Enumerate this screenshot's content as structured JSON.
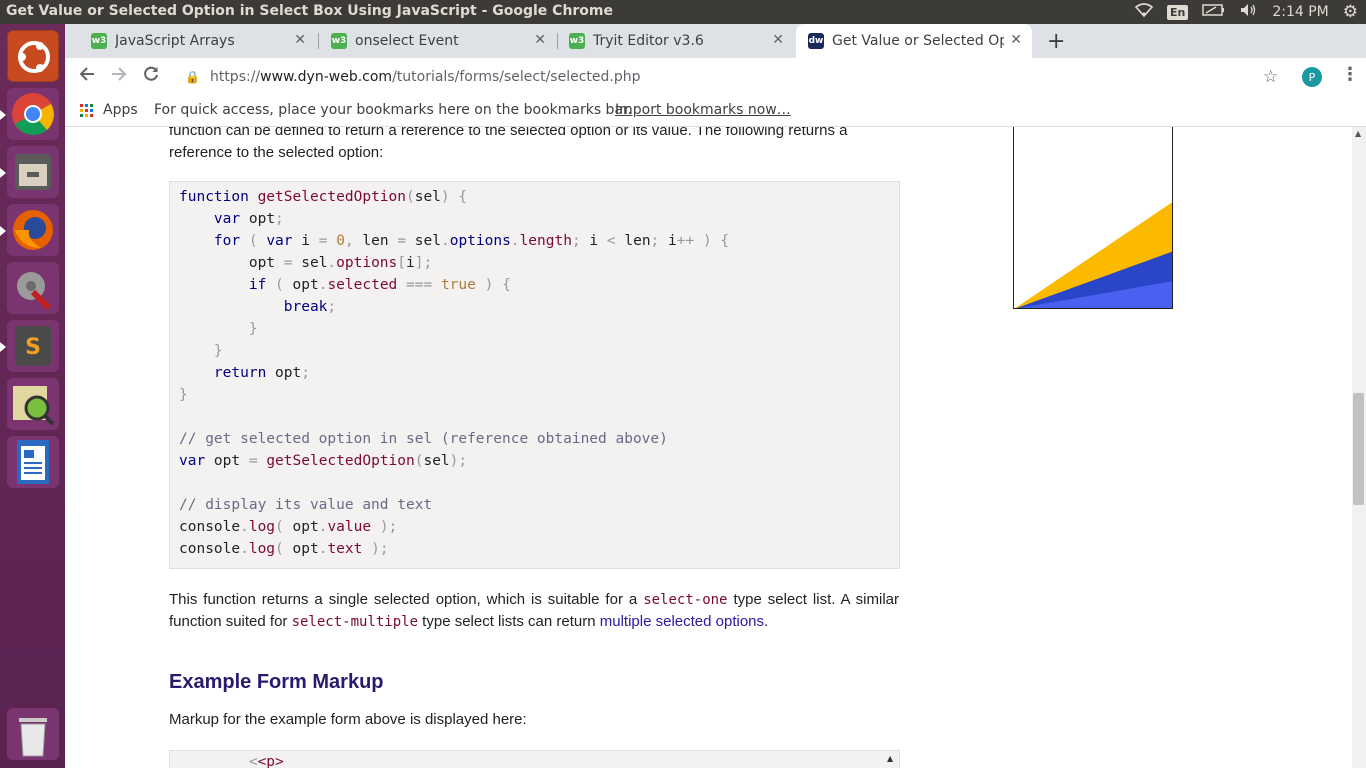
{
  "system": {
    "window_title": "Get Value or Selected Option in Select Box Using JavaScript - Google Chrome",
    "lang": "En",
    "time": "2:14 PM"
  },
  "tabs": [
    {
      "label": "JavaScript Arrays",
      "favicon": "w3"
    },
    {
      "label": "onselect Event",
      "favicon": "w3"
    },
    {
      "label": "Tryit Editor v3.6",
      "favicon": "w3"
    },
    {
      "label": "Get Value or Selected Opt",
      "favicon": "dw"
    }
  ],
  "omnibox": {
    "url_scheme": "https://",
    "url_host": "www.dyn-web.com",
    "url_path": "/tutorials/forms/select/selected.php",
    "profile_initial": "P"
  },
  "bookmarks_bar": {
    "apps_label": "Apps",
    "hint": "For quick access, place your bookmarks here on the bookmarks bar.",
    "import_link": "Import bookmarks now…"
  },
  "content": {
    "intro_line1": "function can be defined to return a reference to the selected option or its value. The following returns a",
    "intro_line2": "reference to the selected option:",
    "after_p1": "This function returns a single selected option, which is suitable for a ",
    "after_code1": "select-one",
    "after_p2": " type select list. A similar function suited for ",
    "after_code2": "select-multiple",
    "after_p3": " type select lists can return ",
    "after_link": "multiple selected options",
    "after_p4": ".",
    "section_heading": "Example Form Markup",
    "section_text": "Markup for the example form above is displayed here:",
    "markup_first_line": "<p>"
  },
  "colors": {
    "launcher": "#5e2750",
    "ad_yellow": "#fbb900",
    "ad_blue": "#2a46c8",
    "ad_lightblue": "#4a60f0"
  }
}
